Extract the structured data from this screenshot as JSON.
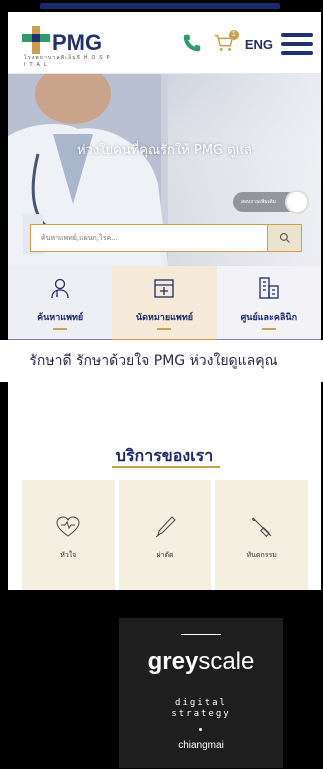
{
  "header": {
    "brand": "PMG",
    "brand_sub": "โรงพยาบาลพีเอ็มจี H O S P I T A L",
    "lang": "ENG",
    "cart_count": "1"
  },
  "hero": {
    "title": "ห่วงใยคนที่คุณรักให้ PMG ดูแล",
    "chat_label": "สอบถามเพิ่มเติม",
    "search_placeholder": "ค้นหาแพทย์,แผนก,โรค..."
  },
  "tabs": [
    {
      "label": "ค้นหาแพทย์"
    },
    {
      "label": "นัดหมายแพทย์"
    },
    {
      "label": "ศูนย์และคลินิก"
    }
  ],
  "tagline": "รักษาดี รักษาด้วยใจ PMG ห่วงใยดูแลคุณ",
  "services": {
    "title": "บริการของเรา",
    "items": [
      {
        "label": "หัวใจ"
      },
      {
        "label": "ผ่าตัด"
      },
      {
        "label": "ทันตกรรม"
      }
    ]
  },
  "greyscale": {
    "brand_bold": "grey",
    "brand_light": "scale",
    "desc1": "digital",
    "desc2": "strategy",
    "city": "chiangmai"
  },
  "colors": {
    "navy": "#1c2a6a",
    "gold": "#c9a14a",
    "cream": "#f5efe1"
  }
}
